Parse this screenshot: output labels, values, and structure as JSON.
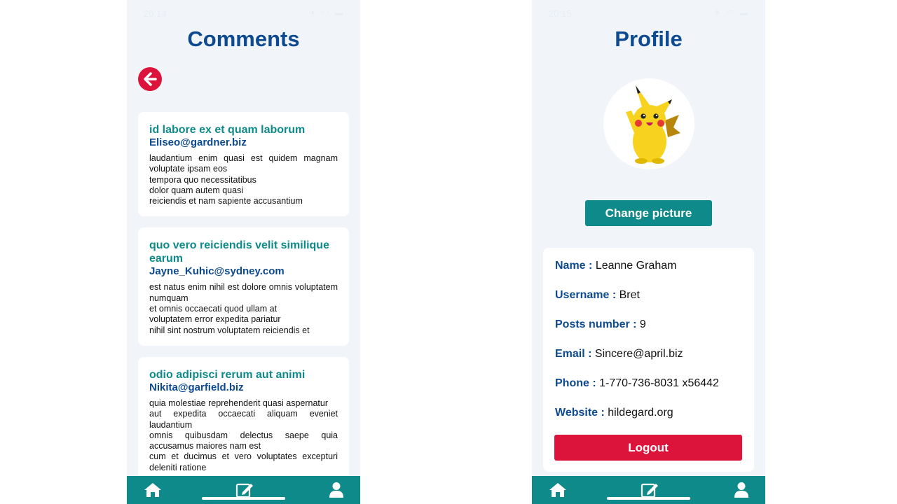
{
  "colors": {
    "primary_blue": "#0d4a8f",
    "teal": "#0f8a8a",
    "red": "#dc143c",
    "background": "#f1f5fa",
    "card": "#ffffff"
  },
  "comments_screen": {
    "status_time": "20:14",
    "title": "Comments",
    "back_icon": "arrow-left-circle-icon",
    "comments": [
      {
        "title": "id labore ex et quam laborum",
        "email": "Eliseo@gardner.biz",
        "body": "laudantium enim quasi est quidem magnam voluptate ipsam eos\ntempora quo necessitatibus\ndolor quam autem quasi\nreiciendis et nam sapiente accusantium"
      },
      {
        "title": "quo vero reiciendis velit similique earum",
        "email": "Jayne_Kuhic@sydney.com",
        "body": "est natus enim nihil est dolore omnis voluptatem numquam\net omnis occaecati quod ullam at\nvoluptatem error expedita pariatur\nnihil sint nostrum voluptatem reiciendis et"
      },
      {
        "title": "odio adipisci rerum aut animi",
        "email": "Nikita@garfield.biz",
        "body": "quia molestiae reprehenderit quasi aspernatur\naut expedita occaecati aliquam eveniet laudantium\nomnis quibusdam delectus saepe quia accusamus maiores nam est\ncum et ducimus et vero voluptates excepturi deleniti ratione"
      }
    ]
  },
  "profile_screen": {
    "status_time": "20:15",
    "title": "Profile",
    "avatar_icon": "pikachu-avatar",
    "change_picture_label": "Change picture",
    "fields": {
      "name": {
        "label": "Name :",
        "value": "Leanne Graham"
      },
      "username": {
        "label": "Username :",
        "value": "Bret"
      },
      "posts": {
        "label": "Posts number :",
        "value": "9"
      },
      "email": {
        "label": "Email :",
        "value": "Sincere@april.biz"
      },
      "phone": {
        "label": "Phone :",
        "value": "1-770-736-8031 x56442"
      },
      "website": {
        "label": "Website :",
        "value": "hildegard.org"
      }
    },
    "logout_label": "Logout"
  },
  "tab_bar": {
    "home_icon": "home-icon",
    "edit_icon": "edit-note-icon",
    "profile_icon": "user-icon"
  }
}
